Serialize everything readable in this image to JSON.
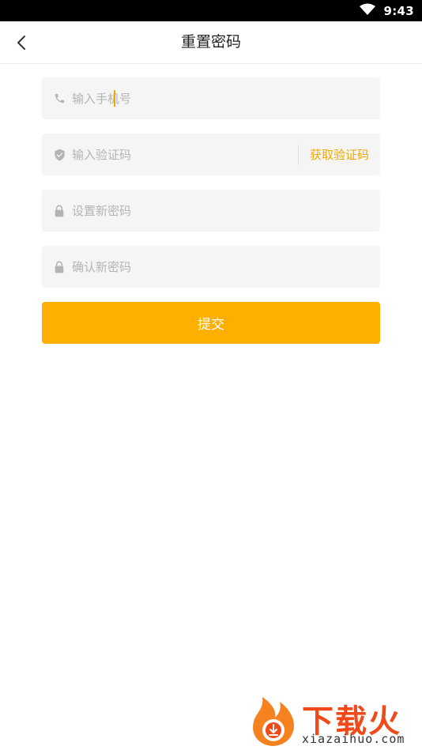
{
  "status_bar": {
    "time": "9:43"
  },
  "header": {
    "title": "重置密码"
  },
  "form": {
    "phone": {
      "placeholder": "输入手机号",
      "icon": "phone-icon"
    },
    "code": {
      "placeholder": "输入验证码",
      "icon": "shield-icon",
      "get_code_label": "获取验证码"
    },
    "new_password": {
      "placeholder": "设置新密码",
      "icon": "lock-icon"
    },
    "confirm_password": {
      "placeholder": "确认新密码",
      "icon": "lock-icon"
    },
    "submit_label": "提交"
  },
  "watermark": {
    "title": "下载火",
    "url": "xiazaihuo.com"
  },
  "colors": {
    "accent": "#ffaf00",
    "link": "#f2a800",
    "field_bg": "#f5f5f5",
    "placeholder": "#b4b4b4"
  }
}
